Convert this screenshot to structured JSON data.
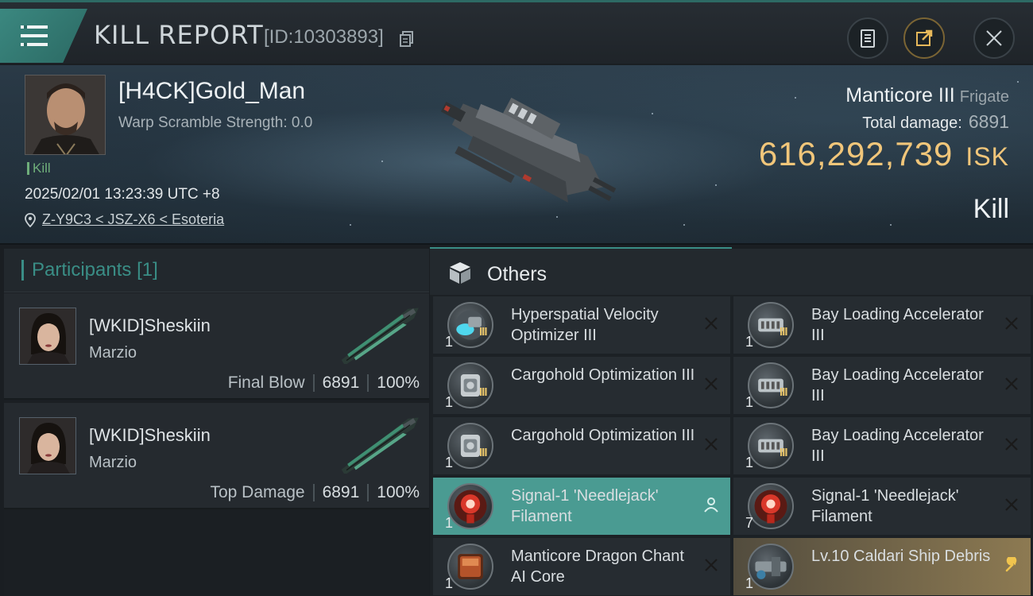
{
  "header": {
    "title": "KILL REPORT",
    "report_id": "[ID:10303893]"
  },
  "victim": {
    "pilot_name": "[H4CK]Gold_Man",
    "warp_scramble": "Warp Scramble Strength: 0.0",
    "kill_tag": "Kill",
    "timestamp": "2025/02/01 13:23:39 UTC +8",
    "location": "Z-Y9C3 < JSZ-X6 < Esoteria",
    "ship_name": "Manticore III",
    "ship_class": "Frigate",
    "total_damage_label": "Total damage:",
    "total_damage": "6891",
    "isk_value": "616,292,739",
    "isk_unit": "ISK",
    "outcome": "Kill"
  },
  "participants": {
    "title": "Participants",
    "count": "[1]",
    "list": [
      {
        "name": "[WKID]Sheskiin",
        "corp": "Marzio",
        "role": "Final Blow",
        "damage": "6891",
        "percent": "100%"
      },
      {
        "name": "[WKID]Sheskiin",
        "corp": "Marzio",
        "role": "Top Damage",
        "damage": "6891",
        "percent": "100%"
      }
    ]
  },
  "others": {
    "title": "Others",
    "items": [
      {
        "name": "Hyperspatial Velocity Optimizer III",
        "qty": "1",
        "tier": "III",
        "icon": "velocity-optimizer-icon",
        "action": "close-icon"
      },
      {
        "name": "Bay Loading Accelerator III",
        "qty": "1",
        "tier": "III",
        "icon": "bay-loading-icon",
        "action": "close-icon"
      },
      {
        "name": "Cargohold Optimization III",
        "qty": "1",
        "tier": "III",
        "icon": "cargohold-icon",
        "action": "close-icon"
      },
      {
        "name": "Bay Loading Accelerator III",
        "qty": "1",
        "tier": "III",
        "icon": "bay-loading-icon",
        "action": "close-icon"
      },
      {
        "name": "Cargohold Optimization III",
        "qty": "1",
        "tier": "III",
        "icon": "cargohold-icon",
        "action": "close-icon"
      },
      {
        "name": "Bay Loading Accelerator III",
        "qty": "1",
        "tier": "III",
        "icon": "bay-loading-icon",
        "action": "close-icon"
      },
      {
        "name": "Signal-1 'Needlejack' Filament",
        "qty": "1",
        "tier": "",
        "icon": "filament-icon",
        "action": "person-icon"
      },
      {
        "name": "Signal-1 'Needlejack' Filament",
        "qty": "7",
        "tier": "",
        "icon": "filament-icon",
        "action": "close-icon"
      },
      {
        "name": "Manticore Dragon Chant AI Core",
        "qty": "1",
        "tier": "",
        "icon": "ai-core-icon",
        "action": "close-icon"
      },
      {
        "name": "Lv.10 Caldari Ship Debris",
        "qty": "1",
        "tier": "",
        "icon": "ship-debris-icon",
        "action": "wrench-icon"
      }
    ]
  },
  "colors": {
    "accent": "#3a8e86",
    "isk": "#f1c67a",
    "highlight_row": "#4a9b92",
    "gold_row": "#8d7a52"
  }
}
